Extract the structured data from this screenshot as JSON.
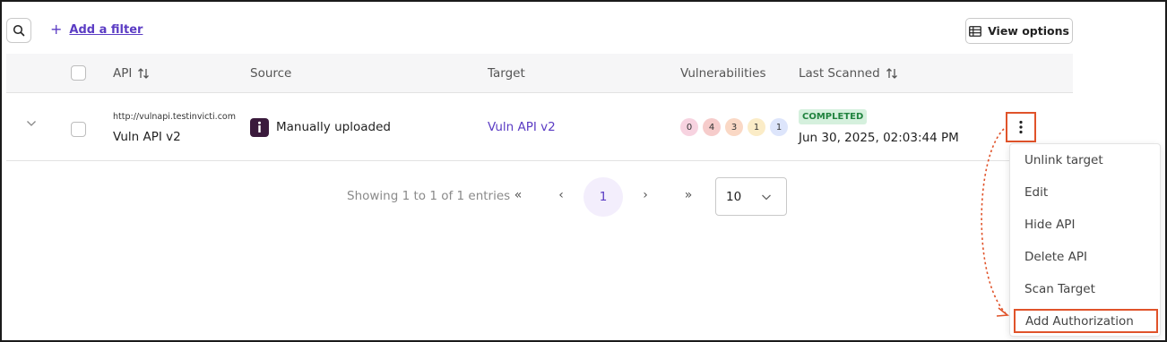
{
  "toolbar": {
    "search_icon": "search-icon",
    "add_filter_label": "Add a filter",
    "view_options_label": "View options",
    "view_options_icon": "table-icon"
  },
  "table": {
    "columns": [
      "API",
      "Source",
      "Target",
      "Vulnerabilities",
      "Last Scanned"
    ],
    "rows": [
      {
        "api_url": "http://vulnapi.testinvicti.com",
        "api_name": "Vuln API v2",
        "source_icon": "invicti-logo-icon",
        "source": "Manually uploaded",
        "target": "Vuln API v2",
        "vulnerabilities": [
          {
            "count": "0",
            "color": "#f7d3e0"
          },
          {
            "count": "4",
            "color": "#f6cccb"
          },
          {
            "count": "3",
            "color": "#fad8c5"
          },
          {
            "count": "1",
            "color": "#fbecc7"
          },
          {
            "count": "1",
            "color": "#dde5fb"
          }
        ],
        "status": "COMPLETED",
        "last_scanned": "Jun 30, 2025, 02:03:44 PM"
      }
    ]
  },
  "pagination": {
    "showing_text": "Showing 1 to 1 of 1 entries",
    "first": "«",
    "prev": "‹",
    "current_page": "1",
    "next": "›",
    "last": "»",
    "page_size": "10"
  },
  "row_menu": {
    "items": [
      "Unlink target",
      "Edit",
      "Hide API",
      "Delete API",
      "Scan Target",
      "Add Authorization"
    ]
  },
  "colors": {
    "accent": "#5b3cc4",
    "highlight": "#e0532a",
    "status_bg": "#d5f0dd",
    "status_text": "#21833f"
  }
}
